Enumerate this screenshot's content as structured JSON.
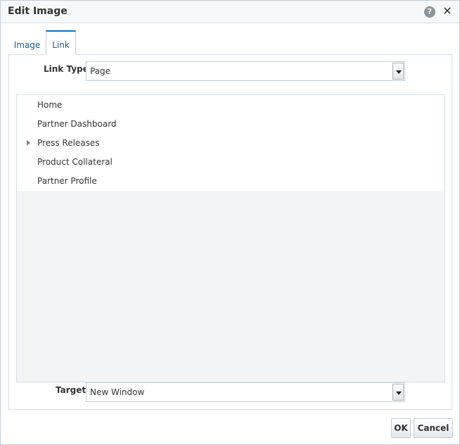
{
  "dialog": {
    "title": "Edit Image",
    "help_icon": "help-icon",
    "help_glyph": "?",
    "close_icon": "close-icon",
    "close_glyph": "✕"
  },
  "tabs": [
    {
      "label": "Image",
      "selected": false
    },
    {
      "label": "Link",
      "selected": true
    }
  ],
  "link_type": {
    "label": "Link Type",
    "value": "Page"
  },
  "tree": {
    "items": [
      {
        "label": "Home",
        "expandable": false
      },
      {
        "label": "Partner Dashboard",
        "expandable": false
      },
      {
        "label": "Press Releases",
        "expandable": true
      },
      {
        "label": "Product Collateral",
        "expandable": false
      },
      {
        "label": "Partner Profile",
        "expandable": false
      }
    ]
  },
  "target": {
    "label": "Target",
    "value": "New Window"
  },
  "buttons": {
    "ok": "OK",
    "cancel": "Cancel"
  },
  "colors": {
    "accent": "#0572ce",
    "tab_text": "#145c9e",
    "tree_empty_bg": "#f2f4f6"
  }
}
